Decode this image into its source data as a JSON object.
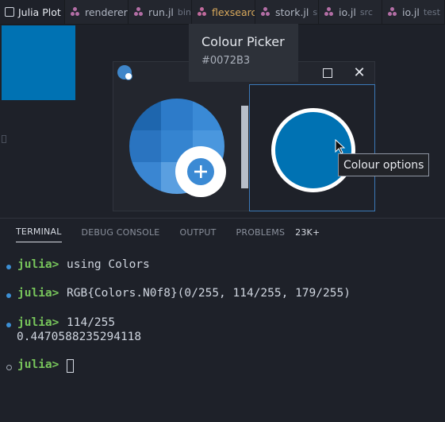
{
  "tabs": [
    {
      "label": "Julia Plot",
      "kind": "plot",
      "active": true
    },
    {
      "label": "renderer",
      "kind": "julia"
    },
    {
      "label": "run.jl",
      "dir": "bin",
      "kind": "julia"
    },
    {
      "label": "flexsearch",
      "kind": "julia-warn"
    },
    {
      "label": "stork.jl",
      "dir": "s",
      "kind": "julia"
    },
    {
      "label": "io.jl",
      "dir": "src",
      "kind": "julia"
    },
    {
      "label": "io.jl",
      "dir": "test",
      "kind": "julia"
    }
  ],
  "tooltip": {
    "title": "Colour Picker",
    "hex": "#0072B3"
  },
  "picker": {
    "selected_color": "#0072b3",
    "options_tooltip": "Colour options"
  },
  "panel": {
    "tabs": [
      "TERMINAL",
      "DEBUG CONSOLE",
      "OUTPUT",
      "PROBLEMS"
    ],
    "problems_badge": "23K+"
  },
  "terminal": {
    "prompt": "julia>",
    "lines": [
      {
        "cmd": "using Colors"
      },
      {
        "cmd": "RGB{Colors.N0f8}(0/255, 114/255, 179/255)"
      },
      {
        "cmd": "114/255",
        "output": "0.4470588235294118"
      }
    ]
  },
  "colors": {
    "accent": "#0072b3",
    "prompt": "#77c45b",
    "background": "#1e2129"
  }
}
